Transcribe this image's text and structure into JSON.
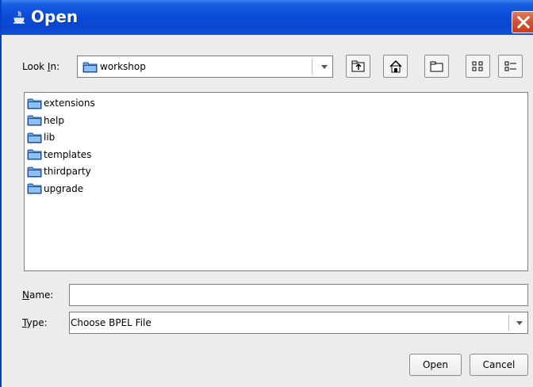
{
  "window": {
    "title": "Open"
  },
  "lookin": {
    "label_pre": "Look ",
    "label_mnemonic": "I",
    "label_post": "n:",
    "value": "workshop"
  },
  "toolbar": {
    "buttons": [
      {
        "icon": "up-folder-icon"
      },
      {
        "icon": "home-icon"
      },
      {
        "icon": "new-folder-icon"
      },
      {
        "icon": "list-view-icon"
      },
      {
        "icon": "details-view-icon"
      }
    ]
  },
  "files": [
    {
      "name": "extensions"
    },
    {
      "name": "help"
    },
    {
      "name": "lib"
    },
    {
      "name": "templates"
    },
    {
      "name": "thirdparty"
    },
    {
      "name": "upgrade"
    }
  ],
  "name_field": {
    "label_mnemonic": "N",
    "label_rest": "ame:",
    "value": ""
  },
  "type_field": {
    "label_mnemonic": "T",
    "label_rest": "ype:",
    "value": "Choose BPEL File"
  },
  "buttons": {
    "open": "Open",
    "cancel": "Cancel"
  },
  "colors": {
    "titlebar": "#0a46d0",
    "close": "#d4502f",
    "folder": "#6aa6e8"
  }
}
